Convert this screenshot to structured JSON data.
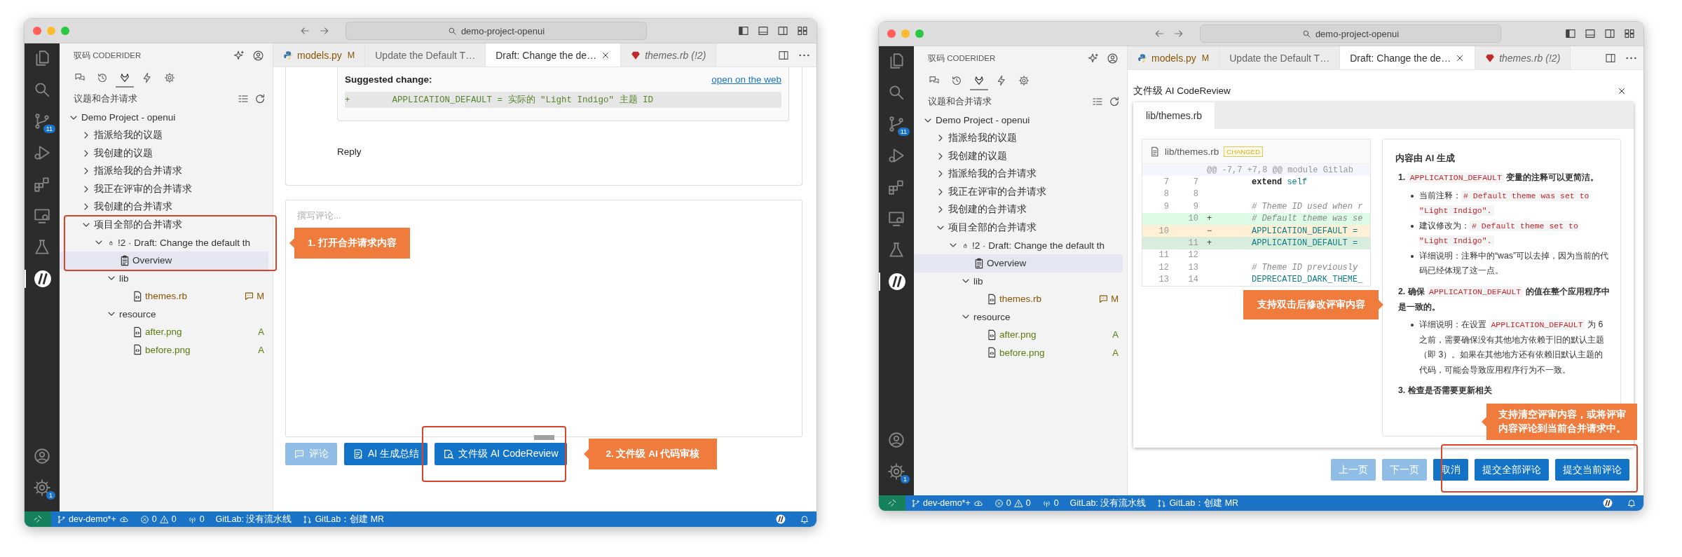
{
  "windows": [
    {
      "kind": "mr_overview",
      "search": "demo-project-openui",
      "activity_bar": {
        "scm_badge": "11",
        "settings_badge": "1"
      },
      "sidebar": {
        "title": "驭码 CODERIDER",
        "view_tabs": [
          {
            "selected": false
          },
          {
            "selected": false
          },
          {
            "selected": true
          },
          {
            "selected": false
          },
          {
            "selected": false
          }
        ],
        "section": "议题和合并请求",
        "tree": [
          {
            "label": "Demo Project - openui",
            "kind": "folder",
            "expanded": true,
            "selected": false,
            "children": [
              {
                "label": "指派给我的议题",
                "kind": "folder",
                "expanded": false,
                "selected": false
              },
              {
                "label": "我创建的议题",
                "kind": "folder",
                "expanded": false,
                "selected": false
              },
              {
                "label": "指派给我的合并请求",
                "kind": "folder",
                "expanded": false,
                "selected": false
              },
              {
                "label": "我正在评审的合并请求",
                "kind": "folder",
                "expanded": false,
                "selected": false
              },
              {
                "label": "我创建的合并请求",
                "kind": "folder",
                "expanded": false,
                "selected": false
              },
              {
                "label": "项目全部的合并请求",
                "kind": "folder",
                "expanded": true,
                "selected": false,
                "children": [
                  {
                    "label": "!2 · Draft: Change the default th",
                    "kind": "mr",
                    "expanded": true,
                    "selected": false,
                    "children": [
                      {
                        "label": "Overview",
                        "kind": "overview",
                        "selected": true
                      },
                      {
                        "label": "lib",
                        "kind": "folder",
                        "expanded": true,
                        "selected": false,
                        "children": [
                          {
                            "label": "themes.rb",
                            "kind": "file",
                            "decoration": "M",
                            "commented": true,
                            "selected": false
                          }
                        ]
                      },
                      {
                        "label": "resource",
                        "kind": "folder",
                        "expanded": true,
                        "selected": false,
                        "children": [
                          {
                            "label": "after.png",
                            "kind": "file",
                            "decoration": "A",
                            "commented": false,
                            "selected": false
                          },
                          {
                            "label": "before.png",
                            "kind": "file",
                            "decoration": "A",
                            "commented": false,
                            "selected": false
                          }
                        ]
                      }
                    ]
                  }
                ]
              }
            ]
          }
        ]
      },
      "tabs": [
        {
          "label": "models.py",
          "kind": "python",
          "decoration": "M",
          "selected": false,
          "preview": false
        },
        {
          "label": "Update the Default T…",
          "kind": "webview",
          "selected": false,
          "preview": false
        },
        {
          "label": "Draft: Change the de…",
          "kind": "webview",
          "selected": true,
          "preview": false
        },
        {
          "label": "themes.rb (!2)",
          "kind": "ruby",
          "selected": false,
          "preview": true
        }
      ],
      "editor": {
        "suggestion": {
          "title": "Suggested change:",
          "link": "open on the web",
          "code": "+        APPLICATION_DEFAULT = 实际的 \"Light Indigo\" 主题 ID"
        },
        "reply": "Reply",
        "comment_placeholder": "撰写评论...",
        "buttons": [
          {
            "label": "评论",
            "disabled": true
          },
          {
            "label": "AI 生成总结",
            "disabled": false
          },
          {
            "label": "文件级 AI CodeReview",
            "disabled": false
          }
        ]
      },
      "status_bar": {
        "branch": "dev-demo*+",
        "errors": "0",
        "warnings": "0",
        "ports": "0",
        "pipeline": "GitLab: 没有流水线",
        "create_mr": "GitLab：创建 MR"
      },
      "callouts": [
        {
          "text": "1. 打开合并请求内容",
          "kind": "left",
          "framed": true
        },
        {
          "text": "2. 文件级 AI 代码审核",
          "kind": "left",
          "framed": true
        }
      ]
    },
    {
      "kind": "ai_review",
      "search": "demo-project-openui",
      "activity_bar": {
        "scm_badge": "11",
        "settings_badge": "1"
      },
      "sidebar": {
        "title": "驭码 CODERIDER",
        "view_tabs": [
          {
            "selected": false
          },
          {
            "selected": false
          },
          {
            "selected": true
          },
          {
            "selected": false
          },
          {
            "selected": false
          }
        ],
        "section": "议题和合并请求",
        "tree": [
          {
            "label": "Demo Project - openui",
            "kind": "folder",
            "expanded": true,
            "selected": false,
            "children": [
              {
                "label": "指派给我的议题",
                "kind": "folder",
                "expanded": false,
                "selected": false
              },
              {
                "label": "我创建的议题",
                "kind": "folder",
                "expanded": false,
                "selected": false
              },
              {
                "label": "指派给我的合并请求",
                "kind": "folder",
                "expanded": false,
                "selected": false
              },
              {
                "label": "我正在评审的合并请求",
                "kind": "folder",
                "expanded": false,
                "selected": false
              },
              {
                "label": "我创建的合并请求",
                "kind": "folder",
                "expanded": false,
                "selected": false
              },
              {
                "label": "项目全部的合并请求",
                "kind": "folder",
                "expanded": true,
                "selected": false,
                "children": [
                  {
                    "label": "!2 · Draft: Change the default th",
                    "kind": "mr",
                    "expanded": true,
                    "selected": false,
                    "children": [
                      {
                        "label": "Overview",
                        "kind": "overview",
                        "selected": true
                      },
                      {
                        "label": "lib",
                        "kind": "folder",
                        "expanded": true,
                        "selected": false,
                        "children": [
                          {
                            "label": "themes.rb",
                            "kind": "file",
                            "decoration": "M",
                            "commented": true,
                            "selected": false
                          }
                        ]
                      },
                      {
                        "label": "resource",
                        "kind": "folder",
                        "expanded": true,
                        "selected": false,
                        "children": [
                          {
                            "label": "after.png",
                            "kind": "file",
                            "decoration": "A",
                            "commented": false,
                            "selected": false
                          },
                          {
                            "label": "before.png",
                            "kind": "file",
                            "decoration": "A",
                            "commented": false,
                            "selected": false
                          }
                        ]
                      }
                    ]
                  }
                ]
              }
            ]
          }
        ]
      },
      "tabs": [
        {
          "label": "models.py",
          "kind": "python",
          "decoration": "M",
          "selected": false,
          "preview": false
        },
        {
          "label": "Update the Default T…",
          "kind": "webview",
          "selected": false,
          "preview": false
        },
        {
          "label": "Draft: Change the de…",
          "kind": "webview",
          "selected": true,
          "preview": false
        },
        {
          "label": "themes.rb (!2)",
          "kind": "ruby",
          "selected": false,
          "preview": true
        }
      ],
      "editor": {
        "title": "文件级 AI CodeReview",
        "file_tabs": [
          {
            "label": "lib/themes.rb",
            "selected": true
          }
        ],
        "diff": {
          "file": "lib/themes.rb",
          "badge": "CHANGED",
          "hunk": "@@ -7,7 +7,8 @@ module Gitlab",
          "lines": [
            {
              "old": "7",
              "new": "7",
              "kind": "context",
              "selected": false,
              "code": [
                {
                  "kind": "keyword",
                  "text": "extend"
                },
                {
                  "kind": "builtin",
                  "text": " self"
                }
              ]
            },
            {
              "old": "8",
              "new": "8",
              "kind": "context",
              "selected": false
            },
            {
              "old": "9",
              "new": "9",
              "kind": "context",
              "selected": false,
              "code": [
                {
                  "kind": "comment",
                  "text": "# Theme ID used when r"
                }
              ]
            },
            {
              "new": "10",
              "sign": "+",
              "kind": "add",
              "selected": false,
              "code": [
                {
                  "kind": "comment",
                  "text": "# Default theme was se"
                }
              ]
            },
            {
              "old": "10",
              "sign": "−",
              "kind": "del",
              "selected": false,
              "code": [
                {
                  "kind": "constant",
                  "text": "APPLICATION_DEFAULT ="
                }
              ]
            },
            {
              "new": "11",
              "sign": "+",
              "kind": "add",
              "selected": true,
              "code": [
                {
                  "kind": "constant",
                  "text": "APPLICATION_DEFAULT ="
                }
              ]
            },
            {
              "old": "11",
              "new": "12",
              "kind": "context",
              "selected": false
            },
            {
              "old": "12",
              "new": "13",
              "kind": "context",
              "selected": false,
              "code": [
                {
                  "kind": "comment",
                  "text": "# Theme ID previously"
                }
              ]
            },
            {
              "old": "13",
              "new": "14",
              "kind": "context",
              "selected": false,
              "code": [
                {
                  "kind": "constant",
                  "text": "DEPRECATED_DARK_THEME_"
                }
              ]
            }
          ]
        },
        "review": {
          "heading": "内容由 AI 生成",
          "items": [
            {
              "number": "1.",
              "heading": [
                {
                  "kind": "code",
                  "text": "APPLICATION_DEFAULT"
                },
                {
                  "kind": "text",
                  "text": " 变量的注释可以更简洁。"
                }
              ],
              "bullets": [
                [
                  {
                    "kind": "text",
                    "text": "当前注释："
                  },
                  {
                    "kind": "code",
                    "text": "# Default theme was set to \"Light Indigo\"."
                  }
                ],
                [
                  {
                    "kind": "text",
                    "text": "建议修改为："
                  },
                  {
                    "kind": "code",
                    "text": "# Default theme set to \"Light Indigo\"."
                  }
                ],
                [
                  {
                    "kind": "text",
                    "text": "详细说明：注释中的“was”可以去掉，因为当前的代码已经体现了这一点。"
                  }
                ]
              ]
            },
            {
              "number": "2.",
              "heading": [
                {
                  "kind": "text",
                  "text": "确保 "
                },
                {
                  "kind": "code",
                  "text": "APPLICATION_DEFAULT"
                },
                {
                  "kind": "text",
                  "text": " 的值在整个应用程序中是一致的。"
                }
              ],
              "bullets": [
                [
                  {
                    "kind": "text",
                    "text": "详细说明：在设置 "
                  },
                  {
                    "kind": "code",
                    "text": "APPLICATION_DEFAULT"
                  },
                  {
                    "kind": "text",
                    "text": " 为 6 之前，需要确保没有其他地方依赖于旧的默认主题（即 3）。如果在其他地方还有依赖旧默认主题的代码，可能会导致应用程序行为不一致。"
                  }
                ]
              ]
            },
            {
              "number": "3.",
              "heading": [
                {
                  "kind": "text",
                  "text": "检查是否需要更新相关"
                }
              ]
            }
          ]
        },
        "buttons": [
          {
            "label": "上一页",
            "disabled": true
          },
          {
            "label": "下一页",
            "disabled": true
          },
          {
            "label": "取消",
            "disabled": false
          },
          {
            "label": "提交全部评论",
            "disabled": false
          },
          {
            "label": "提交当前评论",
            "disabled": false
          }
        ]
      },
      "status_bar": {
        "branch": "dev-demo*+",
        "errors": "0",
        "warnings": "0",
        "ports": "0",
        "pipeline": "GitLab: 没有流水线",
        "create_mr": "GitLab：创建 MR"
      },
      "callouts": [
        {
          "text": "支持双击后修改评审内容",
          "kind": "right",
          "framed": false
        },
        {
          "text": "支持清空评审内容，或将评审内容评论到当前合并请求中。",
          "kind": "left",
          "framed": true
        }
      ]
    }
  ]
}
